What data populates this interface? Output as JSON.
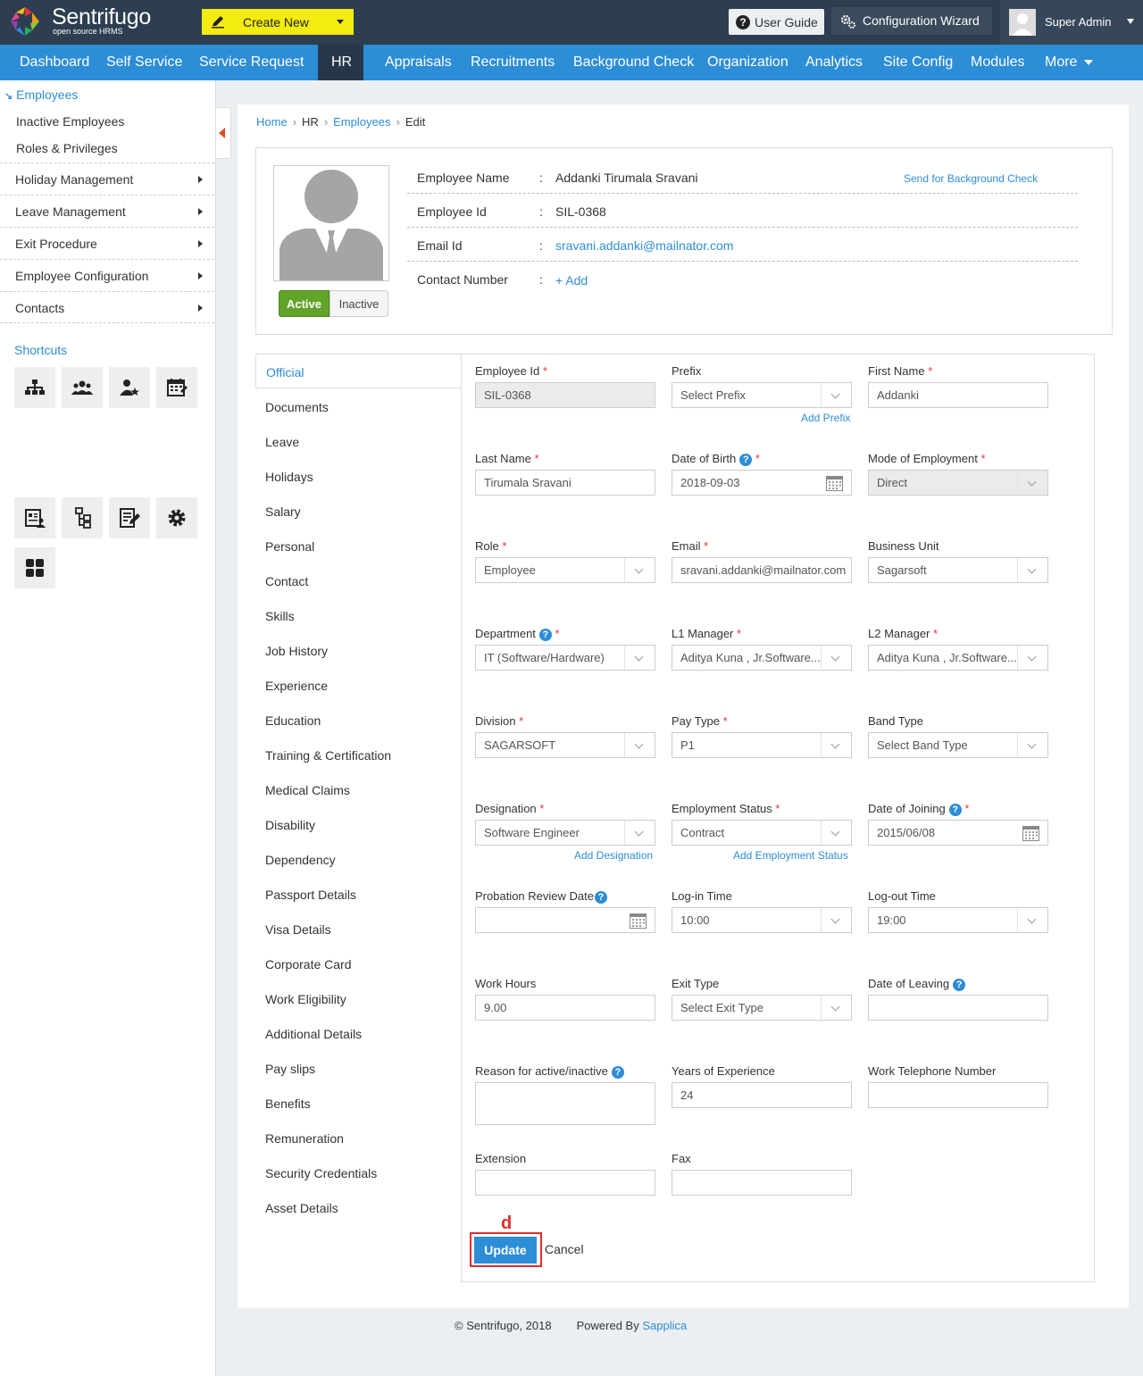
{
  "brand": {
    "name": "Sentrifugo",
    "tagline": "open source HRMS"
  },
  "header": {
    "create_new": "Create New",
    "user_guide": "User Guide",
    "config_wizard": "Configuration Wizard",
    "user_name": "Super Admin"
  },
  "nav": {
    "items": [
      "Dashboard",
      "Self Service",
      "Service Request",
      "HR",
      "Appraisals",
      "Recruitments",
      "Background Check",
      "Organization",
      "Analytics",
      "Site Config",
      "Modules",
      "More"
    ],
    "active": "HR"
  },
  "sidebar": {
    "section": "Employees",
    "subitems": [
      "Inactive Employees",
      "Roles & Privileges"
    ],
    "groups": [
      "Holiday Management",
      "Leave Management",
      "Exit Procedure",
      "Employee Configuration",
      "Contacts"
    ],
    "shortcuts_title": "Shortcuts"
  },
  "breadcrumb": {
    "home": "Home",
    "hr": "HR",
    "employees": "Employees",
    "current": "Edit",
    "sep": "›"
  },
  "profile": {
    "name_label": "Employee Name",
    "name": "Addanki Tirumala Sravani",
    "id_label": "Employee Id",
    "id": "SIL-0368",
    "email_label": "Email Id",
    "email": "sravani.addanki@mailnator.com",
    "contact_label": "Contact Number",
    "contact_add": "+ Add",
    "colon": ":",
    "bg_check": "Send for Background Check",
    "status_active": "Active",
    "status_inactive": "Inactive"
  },
  "tabs": [
    "Official",
    "Documents",
    "Leave",
    "Holidays",
    "Salary",
    "Personal",
    "Contact",
    "Skills",
    "Job History",
    "Experience",
    "Education",
    "Training & Certification",
    "Medical Claims",
    "Disability",
    "Dependency",
    "Passport Details",
    "Visa Details",
    "Corporate Card",
    "Work Eligibility",
    "Additional Details",
    "Pay slips",
    "Benefits",
    "Remuneration",
    "Security Credentials",
    "Asset Details"
  ],
  "active_tab": "Official",
  "form": {
    "employee_id": {
      "label": "Employee Id",
      "value": "SIL-0368"
    },
    "prefix": {
      "label": "Prefix",
      "value": "Select Prefix",
      "link": "Add Prefix"
    },
    "first_name": {
      "label": "First Name",
      "value": "Addanki"
    },
    "last_name": {
      "label": "Last Name",
      "value": "Tirumala Sravani"
    },
    "dob": {
      "label": "Date of Birth",
      "value": "2018-09-03"
    },
    "mode": {
      "label": "Mode of Employment",
      "value": "Direct"
    },
    "role": {
      "label": "Role",
      "value": "Employee"
    },
    "email": {
      "label": "Email",
      "value": "sravani.addanki@mailnator.com"
    },
    "business_unit": {
      "label": "Business Unit",
      "value": "Sagarsoft"
    },
    "department": {
      "label": "Department",
      "value": "IT (Software/Hardware)"
    },
    "l1": {
      "label": "L1 Manager",
      "value": "Aditya Kuna , Jr.Software..."
    },
    "l2": {
      "label": "L2 Manager",
      "value": "Aditya Kuna , Jr.Software..."
    },
    "division": {
      "label": "Division",
      "value": "SAGARSOFT"
    },
    "pay_type": {
      "label": "Pay Type",
      "value": "P1"
    },
    "band_type": {
      "label": "Band Type",
      "value": "Select Band Type"
    },
    "designation": {
      "label": "Designation",
      "value": "Software Engineer",
      "link": "Add Designation"
    },
    "emp_status": {
      "label": "Employment Status",
      "value": "Contract",
      "link": "Add Employment Status"
    },
    "doj": {
      "label": "Date of Joining",
      "value": "2015/06/08"
    },
    "probation": {
      "label": "Probation Review Date",
      "value": ""
    },
    "login": {
      "label": "Log-in Time",
      "value": "10:00"
    },
    "logout": {
      "label": "Log-out Time",
      "value": "19:00"
    },
    "work_hours": {
      "label": "Work Hours",
      "value": "9.00"
    },
    "exit_type": {
      "label": "Exit Type",
      "value": "Select Exit Type"
    },
    "dol": {
      "label": "Date of Leaving",
      "value": ""
    },
    "reason": {
      "label": "Reason for active/inactive",
      "value": ""
    },
    "years_exp": {
      "label": "Years of Experience",
      "value": "24"
    },
    "work_phone": {
      "label": "Work Telephone Number",
      "value": ""
    },
    "extension": {
      "label": "Extension",
      "value": ""
    },
    "fax": {
      "label": "Fax",
      "value": ""
    },
    "required_mark": "*",
    "help_mark": "?"
  },
  "actions": {
    "update": "Update",
    "cancel": "Cancel",
    "marker": "d"
  },
  "footer": {
    "copyright": "© Sentrifugo, 2018",
    "powered": "Powered By",
    "company": "Sapplica"
  },
  "colors": {
    "topbar": "#2c3e50",
    "nav": "#2d8dd6",
    "nav_active": "#26374a",
    "create_new": "#f4eb0f",
    "active_green": "#62a32a",
    "marker_red": "#e32d2d",
    "link": "#2d8dd6"
  }
}
